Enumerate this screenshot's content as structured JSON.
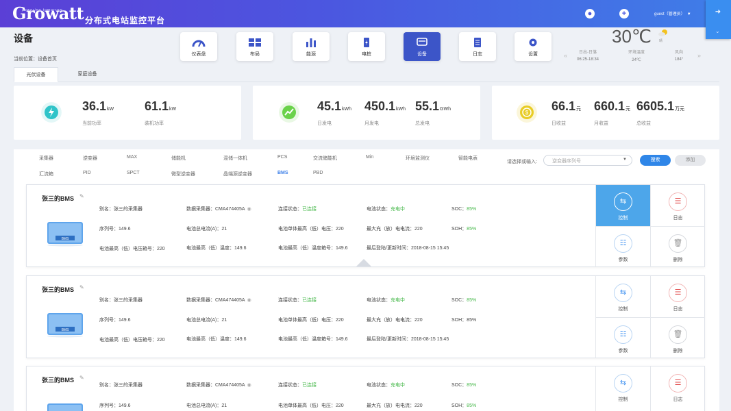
{
  "header": {
    "logo": "Growatt",
    "logo_tagline": "powering tomorrow",
    "platform": "分布式电站监控平台",
    "user": "guest（管理员）"
  },
  "page": {
    "title": "设备",
    "breadcrumb": "当前位置：设备首页"
  },
  "nav": [
    {
      "label": "仪表盘",
      "icon": "gauge-icon"
    },
    {
      "label": "布局",
      "icon": "solar-panel-icon"
    },
    {
      "label": "能源",
      "icon": "bar-chart-icon"
    },
    {
      "label": "电桩",
      "icon": "charging-pile-icon"
    },
    {
      "label": "设备",
      "icon": "device-icon",
      "active": true
    },
    {
      "label": "日志",
      "icon": "log-icon"
    },
    {
      "label": "设置",
      "icon": "gear-icon"
    }
  ],
  "weather": {
    "temperature": "30℃",
    "condition": "晴",
    "sun_label": "日出-日落",
    "sun_value": "06:25-18:34",
    "env_label": "环境温度",
    "env_value": "24℃",
    "wind_label": "风向",
    "wind_value": "184°"
  },
  "subtabs": [
    "光伏设备",
    "家庭设备"
  ],
  "summary": [
    {
      "stats": [
        {
          "value": "36.1",
          "unit": "kW",
          "label": "当前功率"
        },
        {
          "value": "61.1",
          "unit": "kW",
          "label": "装机功率"
        }
      ],
      "icon": "power-icon",
      "color": "#2fc4c9"
    },
    {
      "stats": [
        {
          "value": "45.1",
          "unit": "kWh",
          "label": "日发电"
        },
        {
          "value": "450.1",
          "unit": "kWh",
          "label": "月发电"
        },
        {
          "value": "55.1",
          "unit": "GWh",
          "label": "总发电"
        }
      ],
      "icon": "energy-chart-icon",
      "color": "#6ad24a"
    },
    {
      "stats": [
        {
          "value": "66.1",
          "unit": "元",
          "label": "日收益"
        },
        {
          "value": "660.1",
          "unit": "元",
          "label": "月收益"
        },
        {
          "value": "6605.1",
          "unit": "万元",
          "label": "总收益"
        }
      ],
      "icon": "coin-icon",
      "color": "#e8cc26"
    }
  ],
  "filter": {
    "row1": [
      "采集器",
      "逆变器",
      "MAX",
      "储能机",
      "混储一体机",
      "PCS",
      "交流储能机",
      "Min",
      "环境监测仪",
      "智能电表"
    ],
    "row2": [
      "汇流箱",
      "PID",
      "SPCT",
      "微型逆变器",
      "晶端源逆变器",
      "BMS",
      "PBD"
    ],
    "active": "BMS",
    "select_label": "请选择或输入:",
    "select_placeholder": "逆变器序列号",
    "search_button": "搜索",
    "add_button": "添加"
  },
  "devices": [
    {
      "name": "张三的BMS",
      "alias": "别名：张三的采集器",
      "serial": "序列号：149.6",
      "max_min_cell_box": "电池最高（低）电压箱号：220",
      "collector": "数据采集器：CMA474405A",
      "total_current": "电池总电流(A)：21",
      "max_min_temp": "电池最高（低）温度：149.6",
      "conn_label": "连接状态：",
      "conn_value": "已连接",
      "cell_voltage": "电池单体最高（低）电压：220",
      "temp_box": "电池最高（低）温度箱号：149.6",
      "batt_label": "电池状态：",
      "batt_value": "充电中",
      "max_current": "最大充（放）电电流：220",
      "last_login": "最后登陆/更新时间：2018-08-15 15:45",
      "soc_label": "SOC：",
      "soc_value": "85%",
      "soh_label": "SOH：",
      "soh_value": "85%"
    },
    {
      "name": "张三的BMS",
      "alias": "别名：张三的采集器",
      "serial": "序列号：149.6",
      "max_min_cell_box": "电池最高（低）电压箱号：220",
      "collector": "数据采集器：CMA474405A",
      "total_current": "电池总电流(A)：21",
      "max_min_temp": "电池最高（低）温度：149.6",
      "conn_label": "连接状态：",
      "conn_value": "已连接",
      "cell_voltage": "电池单体最高（低）电压：220",
      "temp_box": "电池最高（低）温度箱号：149.6",
      "batt_label": "电池状态：",
      "batt_value": "充电中",
      "max_current": "最大充（放）电电流：220",
      "last_login": "最后登陆/更新时间：2018-08-15 15:45",
      "soc_label": "SOC：",
      "soc_value": "85%",
      "soh_label": "SOH：",
      "soh_value": "85%"
    },
    {
      "name": "张三的BMS",
      "alias": "别名：张三的采集器",
      "serial": "序列号：149.6",
      "collector": "数据采集器：CMA474405A",
      "total_current": "电池总电流(A)：21",
      "conn_label": "连接状态：",
      "conn_value": "已连接",
      "cell_voltage": "电池单体最高（低）电压：220",
      "batt_label": "电池状态：",
      "batt_value": "充电中",
      "max_current": "最大充（放）电电流：220",
      "soc_label": "SOC：",
      "soc_value": "85%",
      "soh_label": "SOH：",
      "soh_value": "85%"
    }
  ],
  "actions": {
    "control": "控制",
    "log": "日志",
    "params": "参数",
    "delete": "删除"
  },
  "device_badge": "BMS"
}
